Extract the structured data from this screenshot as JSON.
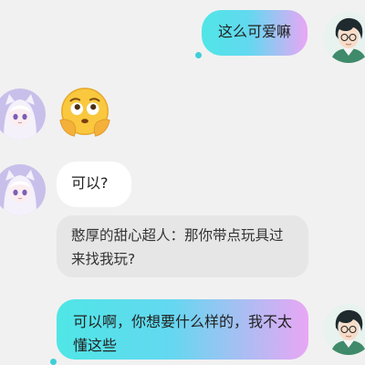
{
  "messages": [
    {
      "id": "m1",
      "side": "sent",
      "text": "这么可爱嘛"
    },
    {
      "id": "m2",
      "side": "received",
      "type": "emoji",
      "emoji": "pleading-face-emoji"
    },
    {
      "id": "m3",
      "side": "received",
      "text": "可以?"
    },
    {
      "id": "m4",
      "side": "received",
      "type": "quote",
      "text": "憨厚的甜心超人：那你带点玩具过来找我玩?"
    },
    {
      "id": "m5",
      "side": "sent",
      "text": "可以啊，你想要什么样的，我不太懂这些"
    }
  ],
  "avatars": {
    "self": "boy-avatar",
    "other": "anime-girl-avatar"
  },
  "colors": {
    "background": "#f1f1f1",
    "sent_gradient_start": "#4fe6e6",
    "sent_gradient_end": "#e9a6f5",
    "received_bubble": "#ffffff",
    "quote_bubble": "#e6e6e6",
    "unread_dot": "#3fcfd8"
  }
}
